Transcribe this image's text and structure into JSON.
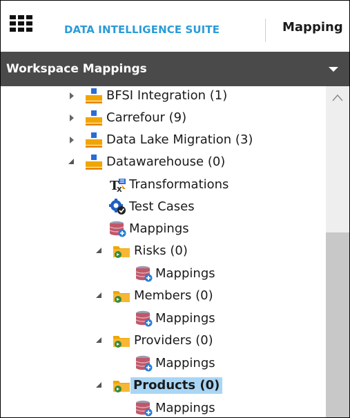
{
  "header": {
    "suite_title": "DATA INTELLIGENCE SUITE",
    "active_tab": "Mapping"
  },
  "panel": {
    "title": "Workspace Mappings"
  },
  "tree": {
    "items": [
      {
        "label": "BFSI Integration (1)",
        "icon": "subject-area-icon",
        "expanded": false
      },
      {
        "label": "Carrefour (9)",
        "icon": "subject-area-icon",
        "expanded": false
      },
      {
        "label": "Data Lake Migration (3)",
        "icon": "subject-area-icon",
        "expanded": false
      },
      {
        "label": "Datawarehouse (0)",
        "icon": "subject-area-icon",
        "expanded": true
      },
      {
        "label": "Transformations",
        "icon": "transformations-icon"
      },
      {
        "label": "Test Cases",
        "icon": "test-cases-icon"
      },
      {
        "label": "Mappings",
        "icon": "mappings-db-icon"
      },
      {
        "label": "Risks (0)",
        "icon": "folder-icon",
        "expanded": true
      },
      {
        "label": "Mappings",
        "icon": "mappings-db-icon"
      },
      {
        "label": "Members (0)",
        "icon": "folder-icon",
        "expanded": true
      },
      {
        "label": "Mappings",
        "icon": "mappings-db-icon"
      },
      {
        "label": "Providers (0)",
        "icon": "folder-icon",
        "expanded": true
      },
      {
        "label": "Mappings",
        "icon": "mappings-db-icon"
      },
      {
        "label": "Products (0)",
        "icon": "folder-icon",
        "expanded": true,
        "selected": true
      },
      {
        "label": "Mappings",
        "icon": "mappings-db-icon"
      }
    ]
  },
  "colors": {
    "accent": "#2a9bd8",
    "panel_bar": "#4a4a4a",
    "selection": "#a9d6f5"
  }
}
